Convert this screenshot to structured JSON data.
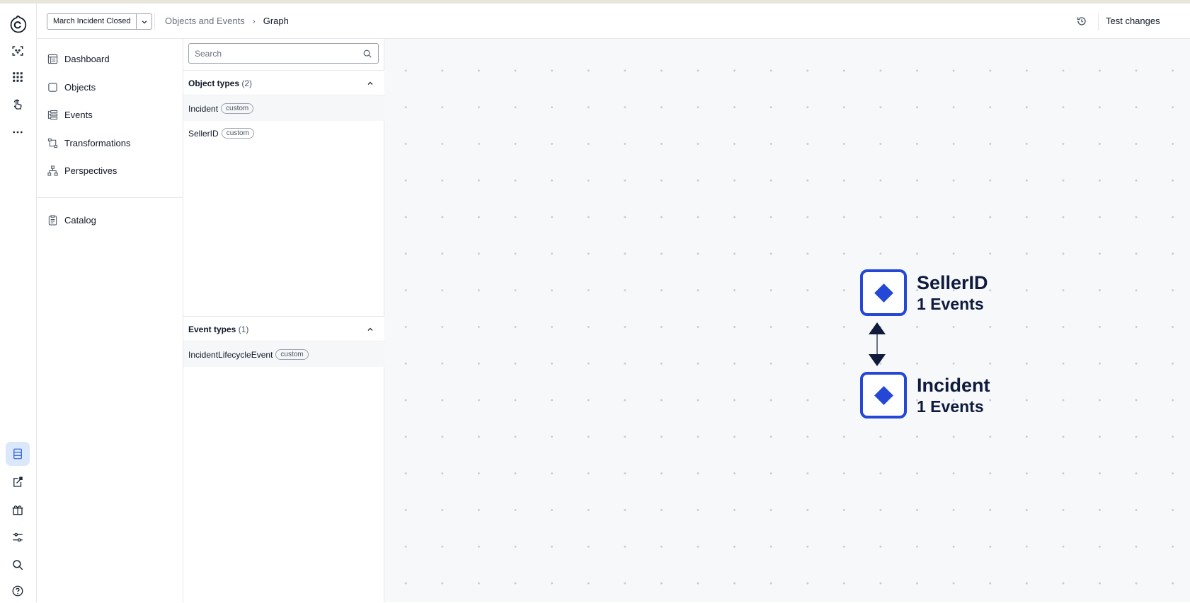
{
  "rail": {
    "icons": [
      "logo-icon",
      "object-scan-icon",
      "apps-grid-icon",
      "touch-icon",
      "more-icon"
    ],
    "bottom_icons": [
      "data-model-icon",
      "export-icon",
      "package-icon",
      "sliders-icon",
      "search-icon",
      "help-icon"
    ]
  },
  "header": {
    "version_label": "March Incident Closed",
    "breadcrumb": [
      "Objects and Events",
      "Graph"
    ],
    "breadcrumb_separator": "›",
    "test_changes_label": "Test changes"
  },
  "nav": {
    "items": [
      {
        "label": "Dashboard",
        "icon": "dashboard-icon"
      },
      {
        "label": "Objects",
        "icon": "objects-icon"
      },
      {
        "label": "Events",
        "icon": "events-icon"
      },
      {
        "label": "Transformations",
        "icon": "transformations-icon"
      },
      {
        "label": "Perspectives",
        "icon": "perspectives-icon"
      }
    ],
    "catalog": {
      "label": "Catalog",
      "icon": "catalog-icon"
    }
  },
  "types_panel": {
    "search_placeholder": "Search",
    "object_types": {
      "title": "Object types",
      "count": "(2)",
      "items": [
        {
          "name": "Incident",
          "badge": "custom"
        },
        {
          "name": "SellerID",
          "badge": "custom"
        }
      ]
    },
    "event_types": {
      "title": "Event types",
      "count": "(1)",
      "items": [
        {
          "name": "IncidentLifecycleEvent",
          "badge": "custom"
        }
      ]
    }
  },
  "graph": {
    "nodes": [
      {
        "name": "SellerID",
        "count": "1 Events"
      },
      {
        "name": "Incident",
        "count": "1 Events"
      }
    ],
    "edge": "bidirectional",
    "accent_color": "#2547d6",
    "text_color": "#0f1a3c"
  }
}
